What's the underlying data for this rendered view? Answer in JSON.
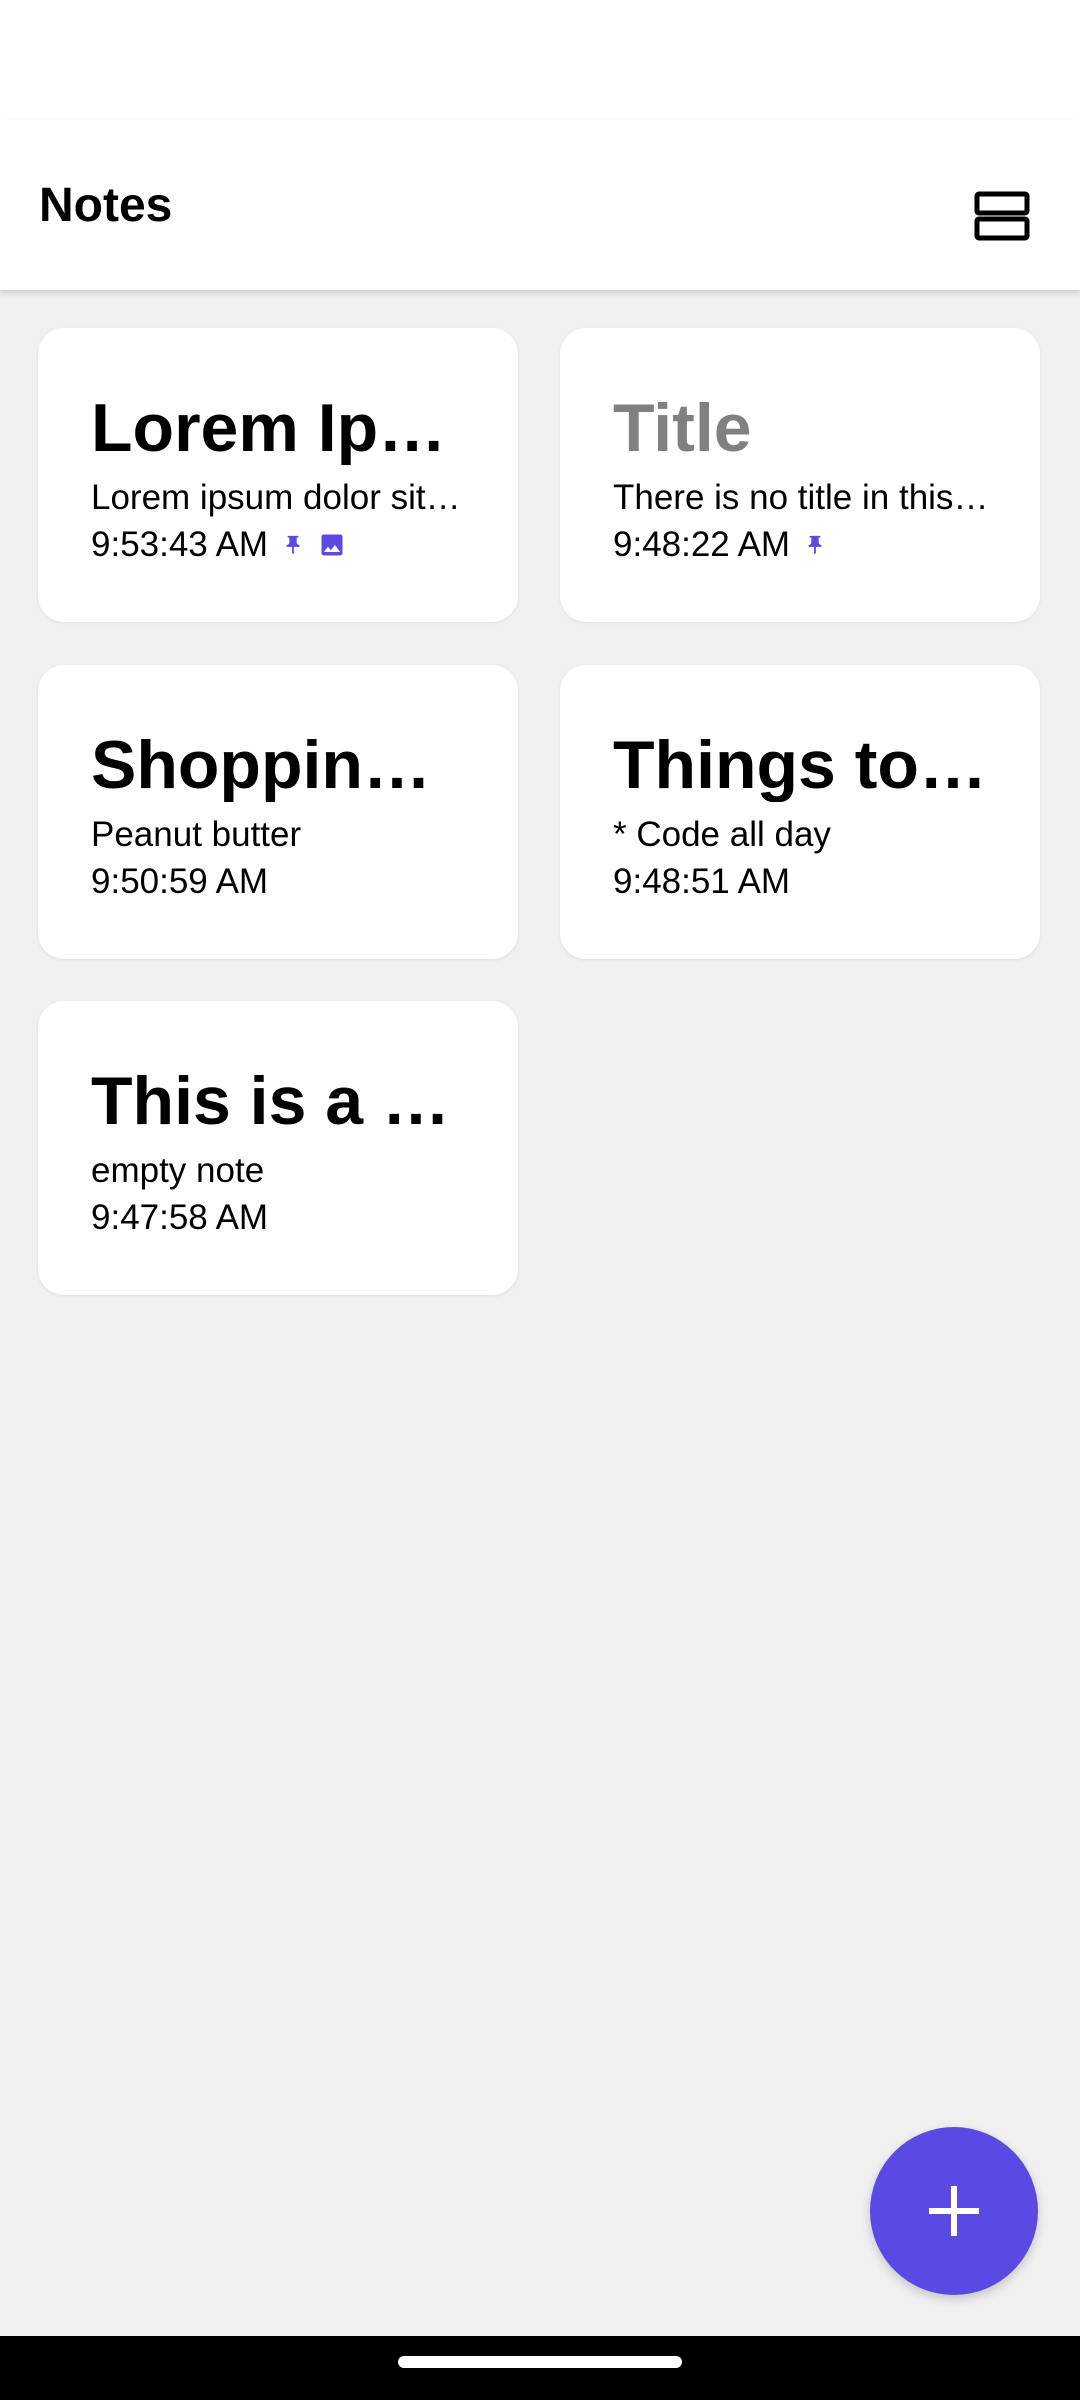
{
  "app": {
    "title": "Notes"
  },
  "icons": {
    "view_toggle": "view-agenda-icon",
    "pin": "pin-icon",
    "image": "image-icon",
    "add": "plus-icon"
  },
  "colors": {
    "accent": "#5a4ae3",
    "background": "#f0f0f0",
    "card": "#ffffff",
    "placeholder_title": "#808080"
  },
  "notes": [
    {
      "title": "Lorem Ipsum",
      "body": "Lorem ipsum dolor sit amet",
      "time": "9:53:43 AM",
      "pinned": true,
      "has_image": true
    },
    {
      "title": "Title",
      "body": "There is no title in this note",
      "time": "9:48:22 AM",
      "pinned": true,
      "has_image": false
    },
    {
      "title": "Shopping list",
      "body": "Peanut butter",
      "time": "9:50:59 AM",
      "pinned": false,
      "has_image": false
    },
    {
      "title": "Things to do",
      "body": "* Code all day",
      "time": "9:48:51 AM",
      "pinned": false,
      "has_image": false
    },
    {
      "title": "This is a title",
      "body": "empty note",
      "time": "9:47:58 AM",
      "pinned": false,
      "has_image": false
    }
  ]
}
